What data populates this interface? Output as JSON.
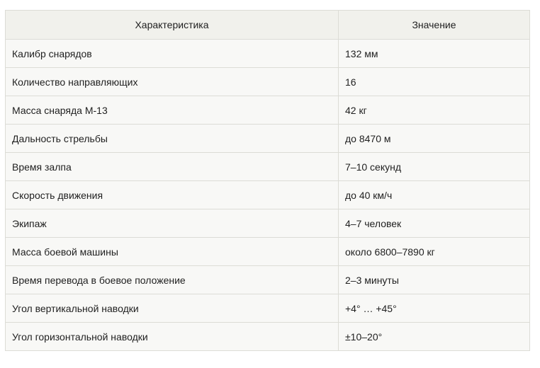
{
  "table": {
    "headers": [
      "Характеристика",
      "Значение"
    ],
    "rows": [
      [
        "Калибр снарядов",
        "132 мм"
      ],
      [
        "Количество направляющих",
        "16"
      ],
      [
        "Масса снаряда М-13",
        "42 кг"
      ],
      [
        "Дальность стрельбы",
        "до 8470 м"
      ],
      [
        "Время залпа",
        "7–10 секунд"
      ],
      [
        "Скорость движения",
        "до 40 км/ч"
      ],
      [
        "Экипаж",
        "4–7 человек"
      ],
      [
        "Масса боевой машины",
        "около 6800–7890 кг"
      ],
      [
        "Время перевода в боевое положение",
        "2–3 минуты"
      ],
      [
        "Угол вертикальной наводки",
        "+4° … +45°"
      ],
      [
        "Угол горизонтальной наводки",
        "±10–20°"
      ]
    ]
  }
}
